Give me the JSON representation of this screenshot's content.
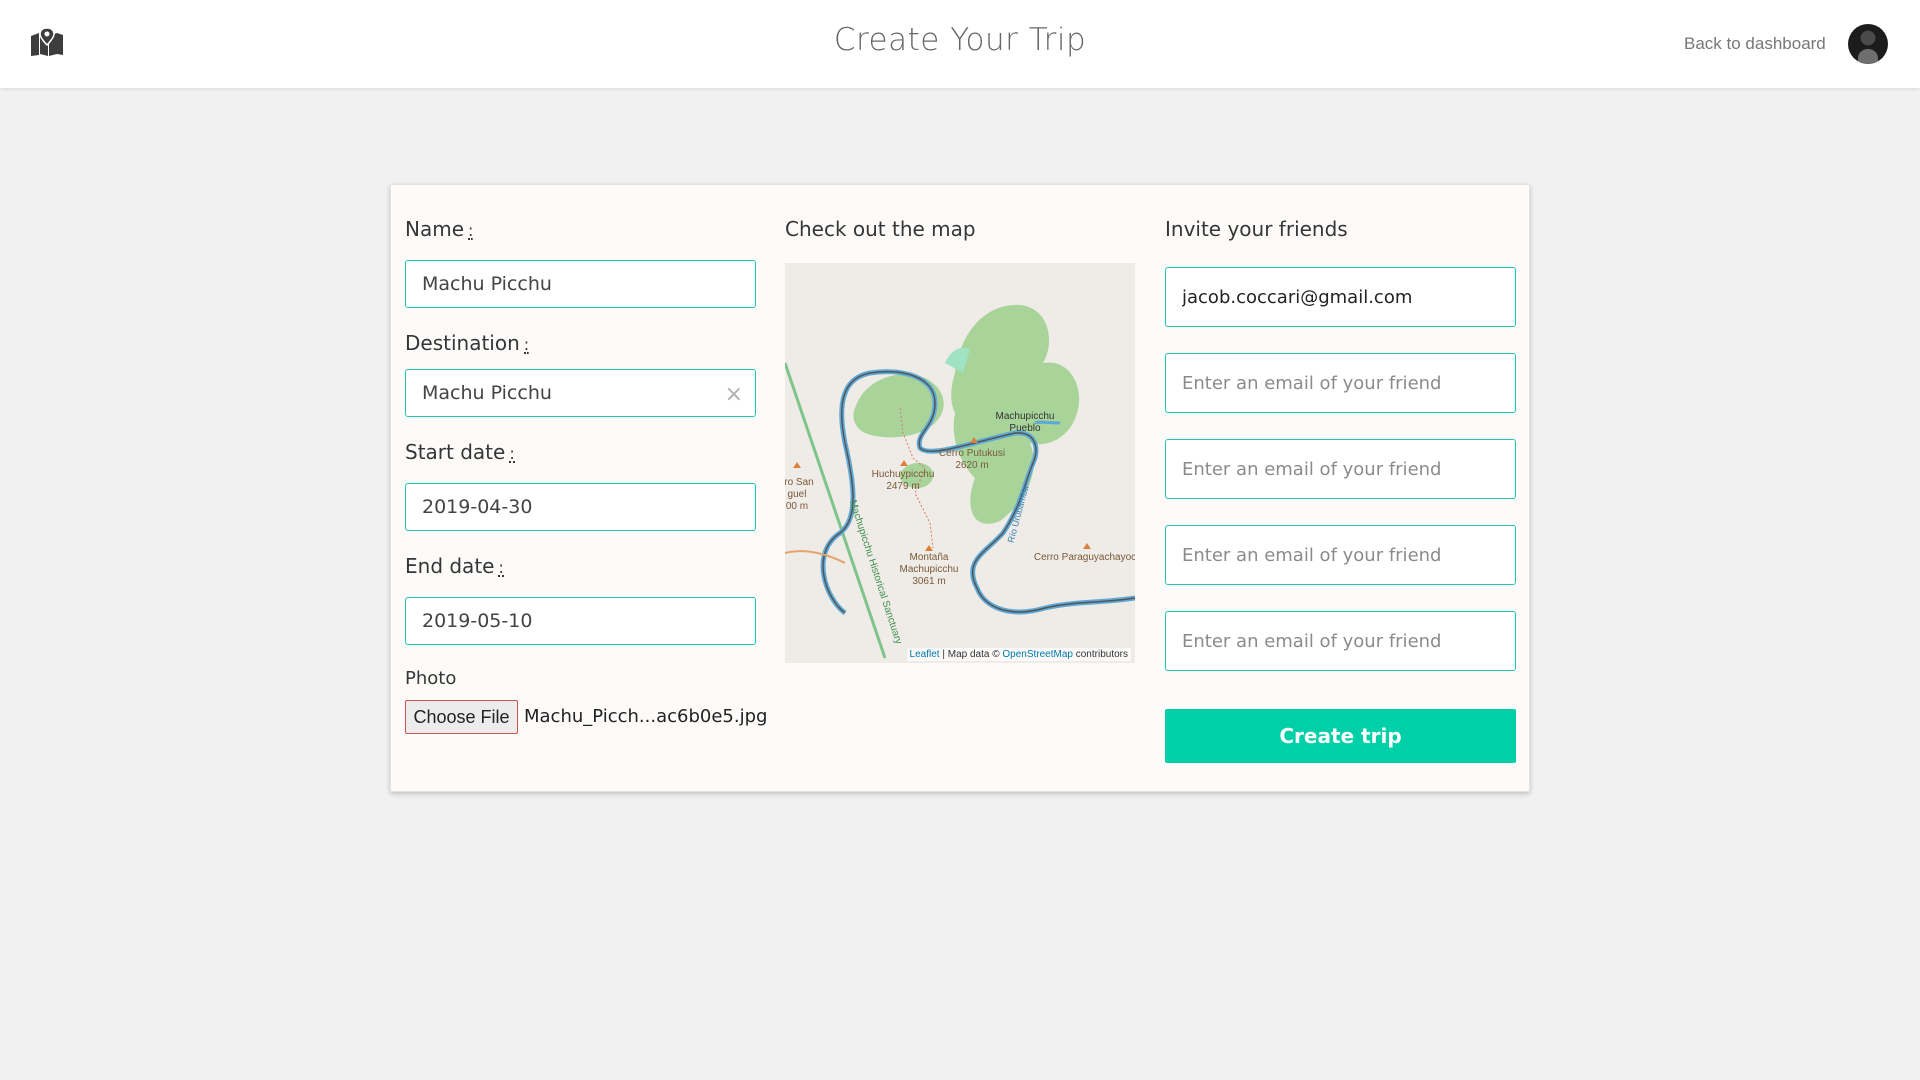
{
  "header": {
    "title": "Create Your Trip",
    "back_link": "Back to dashboard",
    "logo_icon": "map-pin-icon",
    "avatar_icon": "user-avatar"
  },
  "form": {
    "name_label": "Name",
    "name_value": "Machu Picchu",
    "destination_label": "Destination",
    "destination_value": "Machu Picchu",
    "clear_glyph": "×",
    "start_label": "Start date",
    "start_value": "2019-04-30",
    "end_label": "End date",
    "end_value": "2019-05-10",
    "required_mark": ":",
    "photo_label": "Photo",
    "file_button": "Choose File",
    "file_name": "Machu_Picch...ac6b0e5.jpg"
  },
  "map": {
    "title": "Check out the map",
    "labels": {
      "pueblo_1": "Machupicchu",
      "pueblo_2": "Pueblo",
      "putukusi_1": "Cerro Putukusi",
      "putukusi_2": "2620 m",
      "huchuy_1": "Huchuypicchu",
      "huchuy_2": "2479 m",
      "montana_1": "Montaña",
      "montana_2": "Machupicchu",
      "montana_3": "3061 m",
      "paraguay": "Cerro Paraguyachayoc",
      "san_1": "ro San",
      "san_2": "guel",
      "san_3": "00 m",
      "sanctuary": "Machupicchu Historical Sanctuary",
      "river": "Río Urubamba"
    },
    "attribution_leaflet": "Leaflet",
    "attribution_mid": " | Map data © ",
    "attribution_osm": "OpenStreetMap",
    "attribution_end": " contributors"
  },
  "invite": {
    "title": "Invite your friends",
    "email_1": "jacob.coccari@gmail.com",
    "placeholder": "Enter an email of your friend",
    "create_button": "Create trip"
  },
  "colors": {
    "accent": "#00cfa8",
    "field_border": "#1fc8b0"
  }
}
